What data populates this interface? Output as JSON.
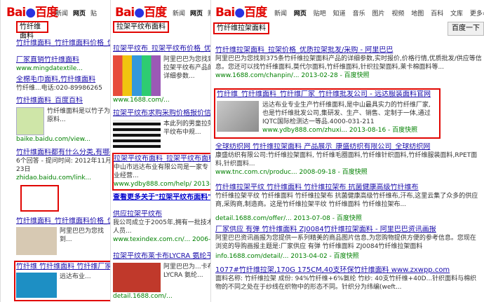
{
  "p1": {
    "logo_a": "Bai",
    "logo_b": "百度",
    "nav": [
      "新闻",
      "网页",
      "贴"
    ],
    "query": "竹纤维面料",
    "results": [
      {
        "title": "竹纤维面料_竹纤维面料价格_优质竹纤维...",
        "desc": "",
        "url": ""
      },
      {
        "title": "厂家直销竹纤维面料",
        "desc": "",
        "url": "www.mingdatextile..."
      },
      {
        "title": "全棉毛巾面料,竹纤维面料",
        "desc": "竹纤维...电话:020-89986265",
        "url": ""
      },
      {
        "title": "竹纤维面料_百度百科",
        "desc": "竹纤维面料是以竹子为原料...",
        "url": "baike.baidu.com/view..."
      },
      {
        "title": "竹纤维面料都有什么分类,有哪些优势?",
        "desc": "6个回答 - 提问时间: 2012年11月23日",
        "url": "zhidao.baidu.com/link..."
      },
      {
        "title": "竹纤维面料_竹纤维面料价格_优质竹纤...",
        "desc": "阿里巴巴为您找到...",
        "url": "www.1688.com/..."
      },
      {
        "title": "竹纤维 竹纤维面料 竹纤维厂家 竹...",
        "desc": "远达布业...",
        "url": "www.ydby888.com/zhu..."
      }
    ]
  },
  "p2": {
    "logo_a": "Bai",
    "logo_b": "百度",
    "nav": [
      "新闻",
      "网页",
      "贴"
    ],
    "query": "拉架平纹布面料",
    "results": [
      {
        "title": "拉架平纹布_拉架平纹布价格_优...",
        "desc": "阿里巴巴为您找到拉架平纹布产品的详细参数...",
        "url": "www.1688.com/..."
      },
      {
        "title": "拉架平纹布求购采购价格报价信息",
        "desc": "本此列的男童拉架平纹布中规...",
        "url": "www.qfc.cn/zh..."
      },
      {
        "title": "拉架平纹布面料_拉架平纹布面料_食...",
        "desc": "中山市远达布业有限公司是一家专业经营...",
        "url": "www.ydby888.com/help/ 2013-06-01"
      },
      {
        "title": "查看更多关于\"拉架平纹布面料\"的图片",
        "desc": "",
        "url": ""
      },
      {
        "title": "供应拉架平纹布",
        "desc": "我公司成立于2005年,拥有一批技术人员...",
        "url": "www.texindex.com.cn/... 2006-09-13"
      },
      {
        "title": "拉架平纹布莱卡布LYCRA 氨纶平纹...",
        "desc": "阿里巴巴为...卡布LYCRA 氨纶...",
        "url": "detail.1688.com/..."
      }
    ]
  },
  "p3": {
    "logo_a": "Bai",
    "logo_b": "百度",
    "nav": [
      "新闻",
      "网页",
      "贴吧",
      "知道",
      "音乐",
      "图片",
      "视频",
      "地图",
      "百科",
      "文库",
      "更多»"
    ],
    "query": "竹纤维拉架面料",
    "button": "百度一下",
    "results": [
      {
        "title": "竹纤维拉架面料_拉架价格_优质拉架批发/采购 - 阿里巴巴",
        "desc": "阿里巴巴为您找到375条竹纤维拉架面料产品的详细参数,实时报价,价格行情,优质批发/供应等信息。您还可以找竹纤维面料,莫代尔面料,竹纤维面料,针织拉架面料,莱卡棉面料等...",
        "url": "www.1688.com/chanpin/... 2013-02-28 - 百度快照"
      },
      {
        "title": "竹纤维_竹纤维面料_竹纤维厂家_竹纤维批发公司 - 远达服装面料官网",
        "desc": "远达布业专业生产竹纤维面料,是中山最具实力的竹纤维厂家,也是竹纤维批发公司,集研发、生产、销售、定制于一体,通过IQTC国际检测达一等品.4000-031-211",
        "url": "www.ydby888.com/zhuxi... 2013-08-16 - 百度快照"
      },
      {
        "title": "全球纺织网 竹纤维拉架面料 产品展示_康盛纺织有限公司_全球纺织网",
        "desc": "康盛纺织有限公司:竹纤维拉架面料, 竹纤维毛圈面料,竹纤维针织面料,竹纤维服装面料,RPET面料,针织面料...",
        "url": "www.tnc.com.cn/produc... 2008-09-18 - 百度快照"
      },
      {
        "title": "竹纤维拉架平纹 竹纤维面料 竹纤维拉架布 抗菌健康高级竹纤维布",
        "desc": "竹纤维拉架平纹 竹纤维面料 竹纤维拉架布 抗菌健康高级竹纤维布,汗布,这里云集了众多的供应商,采购商,制造商。这是竹纤维拉架平纹 竹纤维面料 竹纤维拉架布...",
        "url": "detail.1688.com/offer/... 2013-07-08 - 百度快照"
      },
      {
        "title": "厂家供应 有弹 竹纤维面料 ZJ0084竹纤维拉架面料 - 阿里巴巴资讯画报",
        "desc": "阿里巴巴资讯画报为您提供一系列精美的商品图片信息,为您购物提供方便的参考信息。您现在浏览的导购画报主题是:厂家供应 有弹 竹纤维面料 ZJ0084竹纤维拉架面料",
        "url": "info.1688.com/detail/... 2013-04-02 - 百度快照"
      },
      {
        "title": "1077#竹纤维拉架,170G 175CM,40支环保竹纤维面料 www.zxwpp.com",
        "desc": "面料名称: 竹纤维拉架 成份: 94%竹纤维+6%氨纶 竹纱: 40支竹纤维+40D...针织面料与棉织物的不同之处在于纱线在织物中的形态不同。针织分为纬编(weft...",
        "url": "www.zxwpp.com/..."
      }
    ]
  }
}
